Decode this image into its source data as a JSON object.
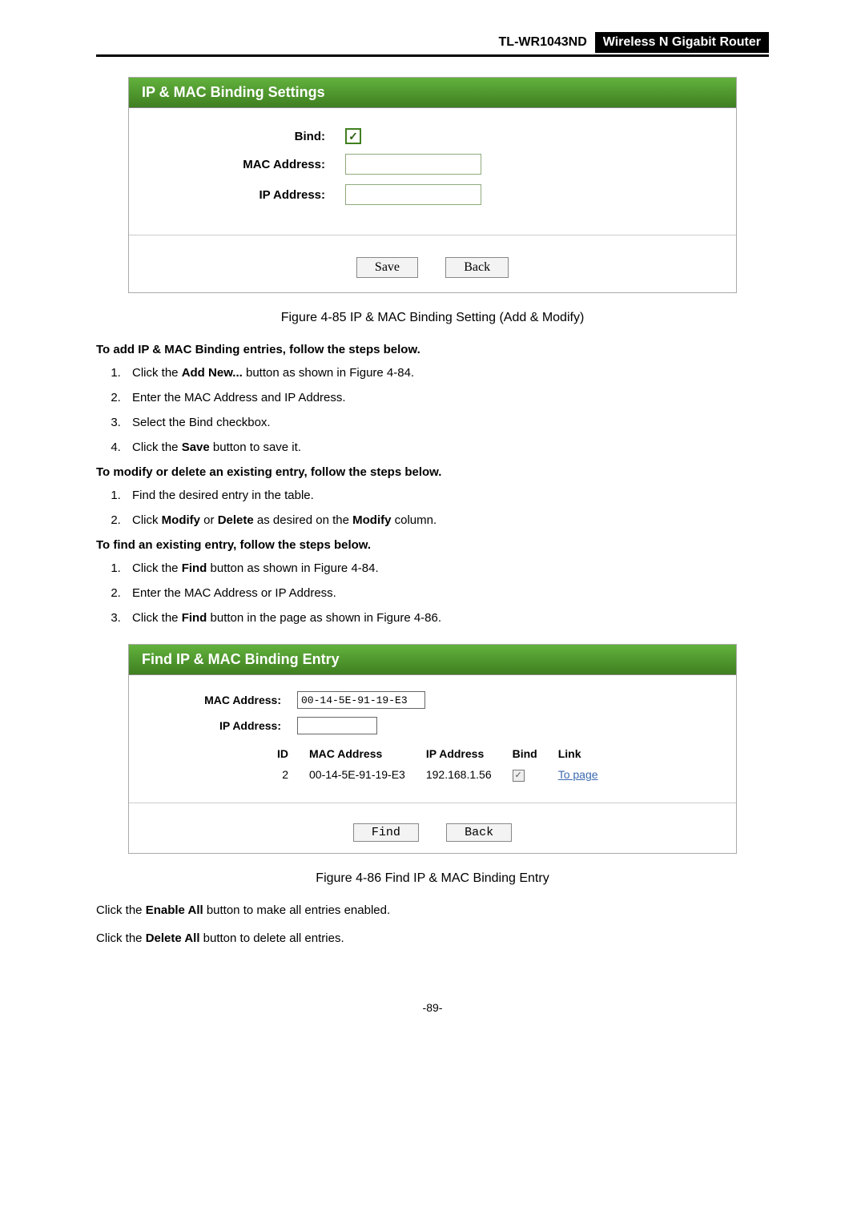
{
  "header": {
    "model": "TL-WR1043ND",
    "title": "Wireless N Gigabit Router"
  },
  "panel1": {
    "title": "IP & MAC Binding Settings",
    "labels": {
      "bind": "Bind:",
      "mac": "MAC Address:",
      "ip": "IP Address:"
    },
    "bind_checked": true,
    "buttons": {
      "save": "Save",
      "back": "Back"
    }
  },
  "caption1": "Figure 4-85    IP & MAC Binding Setting (Add & Modify)",
  "addHeading": "To add IP & MAC Binding entries, follow the steps below.",
  "addSteps": [
    {
      "pre": "Click the ",
      "bold": "Add New...",
      "post": " button as shown in Figure 4-84."
    },
    {
      "text": "Enter the MAC Address and IP Address."
    },
    {
      "text": "Select the Bind checkbox."
    },
    {
      "pre": "Click the ",
      "bold": "Save",
      "post": " button to save it."
    }
  ],
  "modifyHeading": "To modify or delete an existing entry, follow the steps below.",
  "modifySteps": [
    {
      "text": "Find the desired entry in the table."
    },
    {
      "pre": "Click ",
      "bold": "Modify",
      "post1": " or ",
      "bold2": "Delete",
      "post2": " as desired on the ",
      "bold3": "Modify",
      "post3": " column."
    }
  ],
  "findHeading": "To find an existing entry, follow the steps below.",
  "findSteps": [
    {
      "pre": "Click the ",
      "bold": "Find",
      "post": " button as shown in Figure 4-84."
    },
    {
      "text": "Enter the MAC Address or IP Address."
    },
    {
      "pre": "Click the ",
      "bold": "Find",
      "post": " button in the page as shown in Figure 4-86."
    }
  ],
  "panel2": {
    "title": "Find IP & MAC Binding Entry",
    "labels": {
      "mac": "MAC Address:",
      "ip": "IP Address:"
    },
    "macValue": "00-14-5E-91-19-E3",
    "tableHeaders": {
      "id": "ID",
      "mac": "MAC Address",
      "ip": "IP Address",
      "bind": "Bind",
      "link": "Link"
    },
    "row": {
      "id": "2",
      "mac": "00-14-5E-91-19-E3",
      "ip": "192.168.1.56",
      "link": "To page"
    },
    "buttons": {
      "find": "Find",
      "back": "Back"
    }
  },
  "caption2": "Figure 4-86    Find IP & MAC Binding Entry",
  "enableAll": {
    "pre": "Click the ",
    "bold": "Enable All",
    "post": " button to make all entries enabled."
  },
  "deleteAll": {
    "pre": "Click the ",
    "bold": "Delete All",
    "post": " button to delete all entries."
  },
  "pageNumber": "-89-"
}
